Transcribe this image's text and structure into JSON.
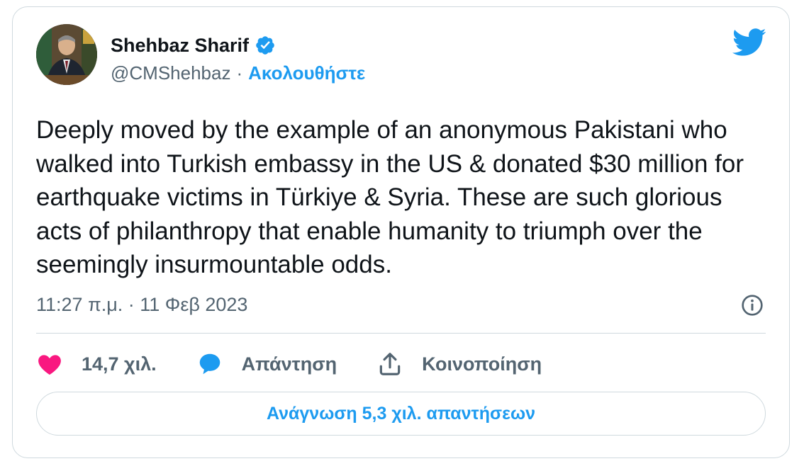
{
  "author": {
    "name": "Shehbaz Sharif",
    "handle": "@CMShehbaz",
    "separator": "·",
    "follow_label": "Ακολουθήστε",
    "verified": true
  },
  "tweet": {
    "text": "Deeply moved by the example of an anonymous Pakistani who walked into Turkish embassy in the US & donated $30 million for earthquake victims in Türkiye & Syria. These are such glorious acts of philanthropy that enable humanity to triumph over the seemingly insurmountable odds.",
    "timestamp": "11:27 π.μ. · 11 Φεβ 2023"
  },
  "actions": {
    "like_count": "14,7 χιλ.",
    "reply_label": "Απάντηση",
    "share_label": "Κοινοποίηση"
  },
  "replies_button": {
    "label": "Ανάγνωση 5,3 χιλ. απαντήσεων"
  },
  "icons": {
    "brand": "twitter-bird-icon",
    "verified": "verified-badge-icon",
    "info": "info-icon",
    "like": "heart-icon",
    "reply": "speech-bubble-icon",
    "share": "share-upload-icon"
  },
  "colors": {
    "accent": "#1d9bf0",
    "like": "#f91880",
    "text_primary": "#0f1419",
    "text_secondary": "#536471",
    "border": "#cfd9de"
  }
}
